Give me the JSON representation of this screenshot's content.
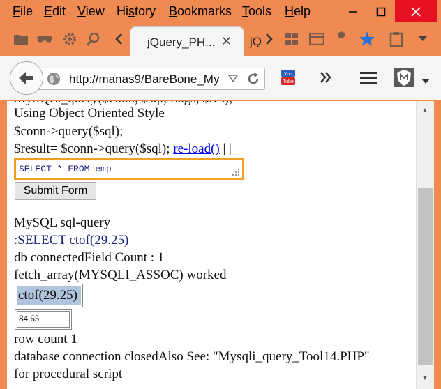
{
  "menu": {
    "items": [
      {
        "label": "File",
        "key": "F"
      },
      {
        "label": "Edit",
        "key": "E"
      },
      {
        "label": "View",
        "key": "V"
      },
      {
        "label": "History",
        "key": "s"
      },
      {
        "label": "Bookmarks",
        "key": "B"
      },
      {
        "label": "Tools",
        "key": "T"
      },
      {
        "label": "Help",
        "key": "H"
      }
    ]
  },
  "tabs": {
    "active": {
      "label": "jQuery_PH..."
    },
    "next": {
      "label": "jQ"
    }
  },
  "toolbar": {
    "url": "http://manas9/BareBone_My"
  },
  "content": {
    "line_partial": "MySQLi_query($conn, $sql, flags, $res);",
    "line_oo_style": "Using Object Oriented Style",
    "line_conn_query": "$conn->query($sql);",
    "line_result_prefix": "$result= $conn->query($sql);",
    "reload_link": "re-load()",
    "line_result_suffix": "| |",
    "sql_input_value": "SELECT * FROM emp",
    "submit_label": "Submit Form",
    "mysql_heading": "MySQL sql-query",
    "sql_query_line": ":SELECT ctof(29.25)",
    "db_status": "db connectedField Count : 1",
    "fetch_status": "fetch_array(MYSQLI_ASSOC) worked",
    "column_header": "ctof(29.25)",
    "result_value": "84.65",
    "row_count": "row count 1",
    "closed_line": "database connection closedAlso See: \"Mysqli_query_Tool14.PHP\"",
    "procedural_line": "for procedural script"
  },
  "colors": {
    "frame": "#ee8a52",
    "close_button": "#e81123",
    "input_highlight": "#f0a020",
    "link": "#0000ee",
    "navy_text": "#1a237e",
    "header_cell": "#b0c4de"
  }
}
